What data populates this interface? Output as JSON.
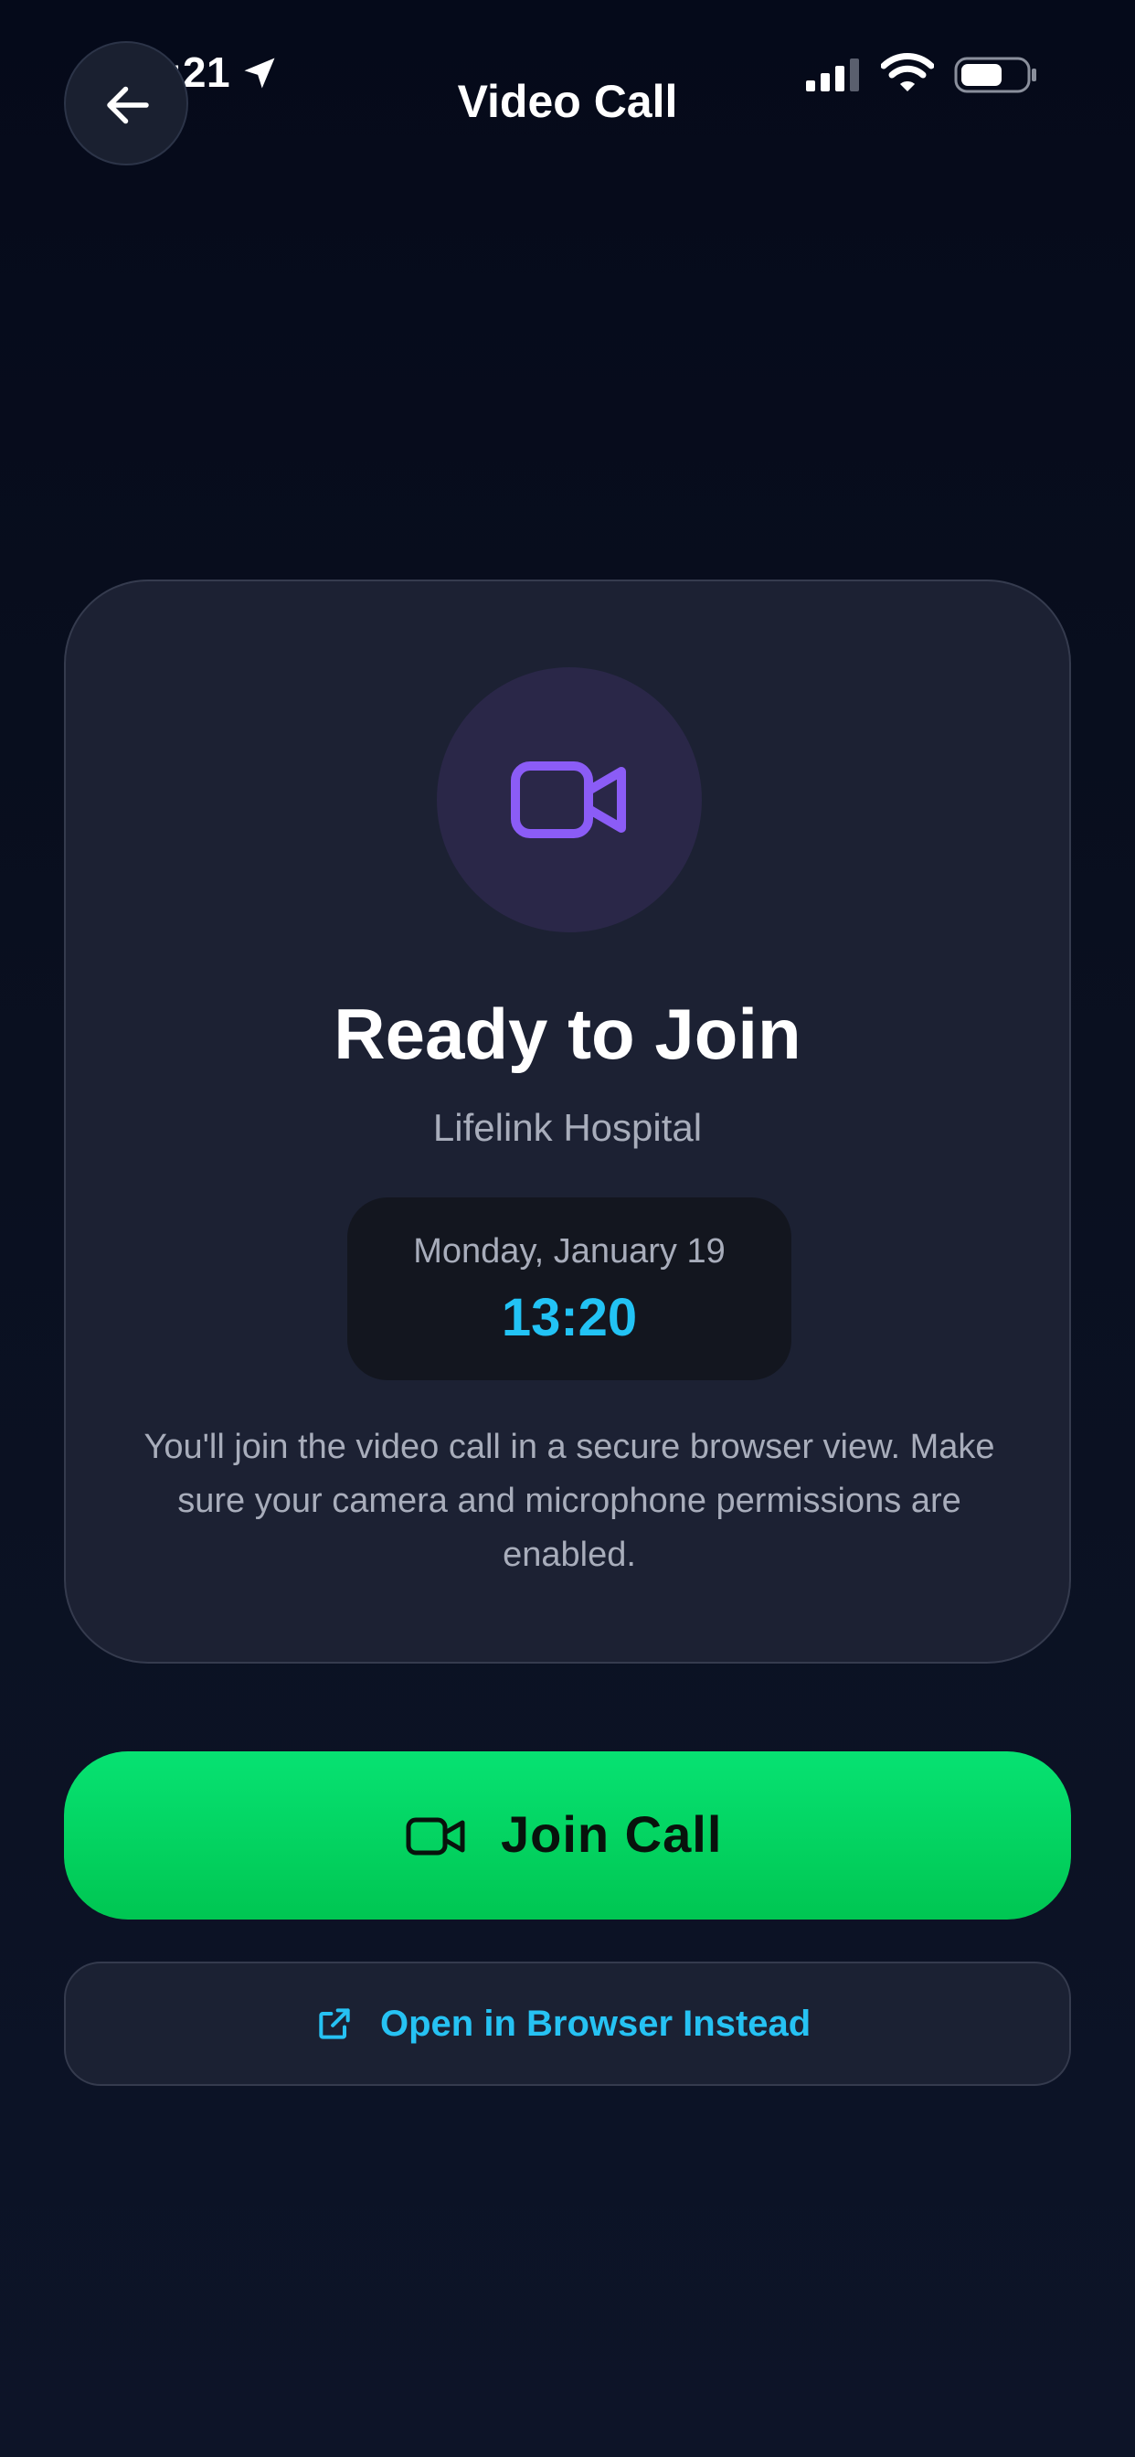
{
  "status_bar": {
    "time": "1:21",
    "icons": [
      "location-arrow-icon",
      "signal-icon",
      "wifi-icon",
      "battery-icon"
    ]
  },
  "header": {
    "back_icon": "arrow-left-icon",
    "title": "Video Call"
  },
  "card": {
    "icon": "video-camera-icon",
    "title": "Ready to Join",
    "subtitle": "Lifelink Hospital",
    "date": "Monday, January 19",
    "time": "13:20",
    "note": "You'll join the video call in a secure browser view. Make sure your camera and microphone permissions are enabled."
  },
  "actions": {
    "join_label": "Join Call",
    "join_icon": "video-camera-icon",
    "browser_label": "Open in Browser Instead",
    "browser_icon": "external-link-icon"
  },
  "colors": {
    "background": "#0a1020",
    "card": "#1c2133",
    "accent_purple": "#8b5cf6",
    "accent_cyan": "#22c3f5",
    "join_green": "#00d35f"
  }
}
